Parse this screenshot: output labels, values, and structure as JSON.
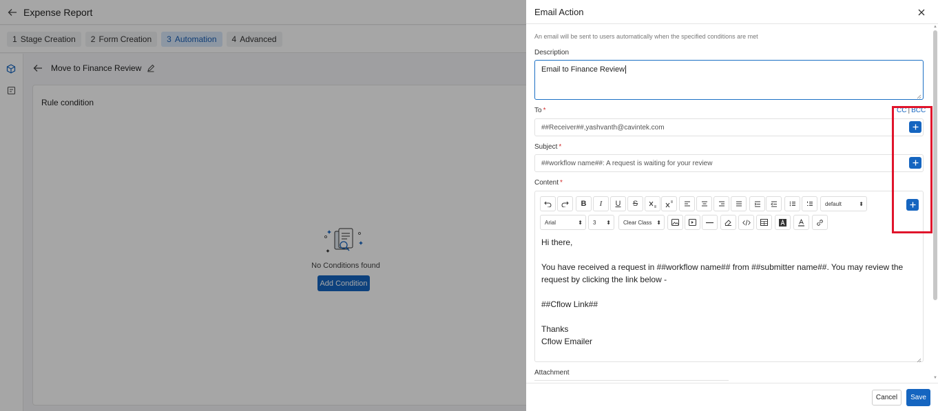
{
  "app": {
    "title": "Expense Report",
    "steps": [
      {
        "num": "1",
        "label": "Stage Creation"
      },
      {
        "num": "2",
        "label": "Form Creation"
      },
      {
        "num": "3",
        "label": "Automation"
      },
      {
        "num": "4",
        "label": "Advanced"
      }
    ],
    "active_step": 2,
    "rule_name": "Move to Finance Review",
    "rule_card_title": "Rule condition",
    "empty_text": "No Conditions found",
    "add_condition_label": "Add Condition"
  },
  "drawer": {
    "title": "Email Action",
    "hint": "An email will be sent to users automatically when the specified conditions are met",
    "description_label": "Description",
    "description_value": "Email to Finance Review",
    "to_label": "To",
    "to_value": "##Receiver##,yashvanth@cavintek.com",
    "cc_label": "CC",
    "bcc_label": "BCC",
    "cc_sep": "|",
    "subject_label": "Subject",
    "subject_value": "##workflow name##: A request is waiting for your review",
    "content_label": "Content",
    "required_mark": "*",
    "toolbar": {
      "format_select": "default",
      "font_select": "Arial",
      "size_select": "3",
      "class_select": "Clear Class"
    },
    "content_lines": [
      "Hi there,",
      "",
      "You have received a request in ##workflow name## from ##submitter name##. You may review the request by clicking the link below -",
      "",
      "##Cflow Link##",
      "",
      "Thanks",
      "Cflow Emailer"
    ],
    "attachment_label": "Attachment",
    "cancel_label": "Cancel",
    "save_label": "Save"
  },
  "colors": {
    "primary": "#1565c0",
    "highlight": "#e0142b",
    "overlay": "rgba(0,0,0,0.35)"
  }
}
